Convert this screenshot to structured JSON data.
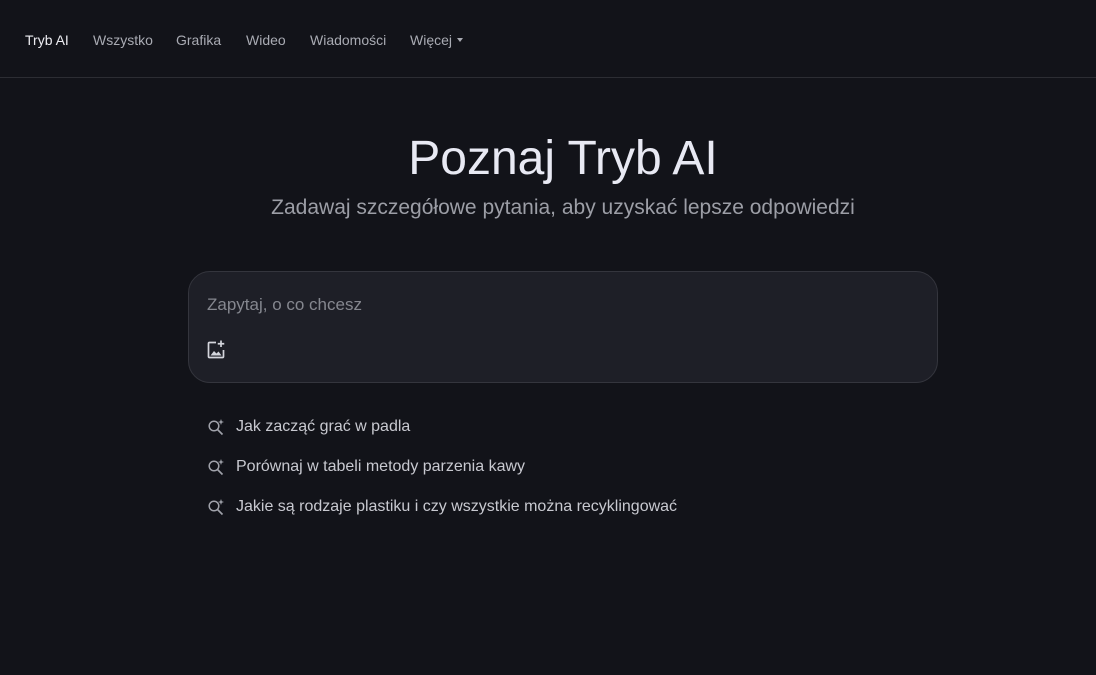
{
  "nav": {
    "items": [
      {
        "label": "Tryb AI",
        "active": true
      },
      {
        "label": "Wszystko",
        "active": false
      },
      {
        "label": "Grafika",
        "active": false
      },
      {
        "label": "Wideo",
        "active": false
      },
      {
        "label": "Wiadomości",
        "active": false
      }
    ],
    "more_label": "Więcej"
  },
  "hero": {
    "title": "Poznaj Tryb AI",
    "subtitle": "Zadawaj szczegółowe pytania, aby uzyskać lepsze odpowiedzi"
  },
  "search": {
    "placeholder": "Zapytaj, o co chcesz",
    "value": "",
    "image_button_icon": "add-image-icon"
  },
  "suggestions": {
    "icon": "sparkle-search-icon",
    "items": [
      "Jak zacząć grać w padla",
      "Porównaj w tabeli metody parzenia kawy",
      "Jakie są rodzaje plastiku i czy wszystkie można recyklingować"
    ]
  },
  "colors": {
    "background": "#121319",
    "search_box": "#1e1f27",
    "nav_active": "#ececf1",
    "nav_inactive": "#a9abb3"
  }
}
